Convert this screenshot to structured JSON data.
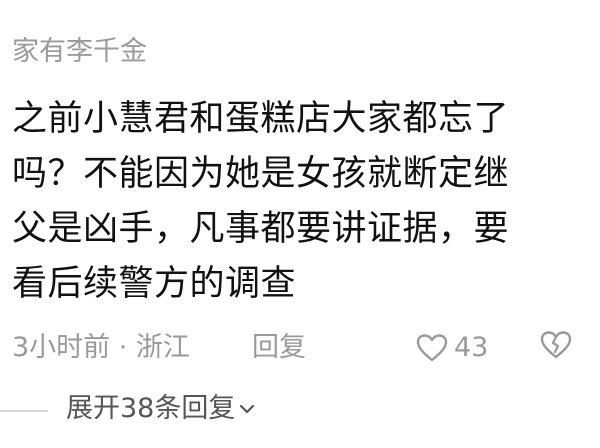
{
  "comment": {
    "username": "家有李千金",
    "body_lines": [
      "之前小慧君和蛋糕店大家都忘了",
      "吗？不能因为她是女孩就断定继",
      "父是凶手，凡事都要讲证据，要",
      "看后续警方的调查"
    ],
    "meta": {
      "time_location": "3小时前 · 浙江",
      "reply_label": "回复",
      "like_count": "43"
    },
    "expand_label": "展开38条回复",
    "icons": {
      "like": "heart-outline-icon",
      "dislike": "broken-heart-icon",
      "expand": "chevron-down-icon"
    },
    "colors": {
      "text": "#111111",
      "muted": "#9a9a9a"
    }
  }
}
